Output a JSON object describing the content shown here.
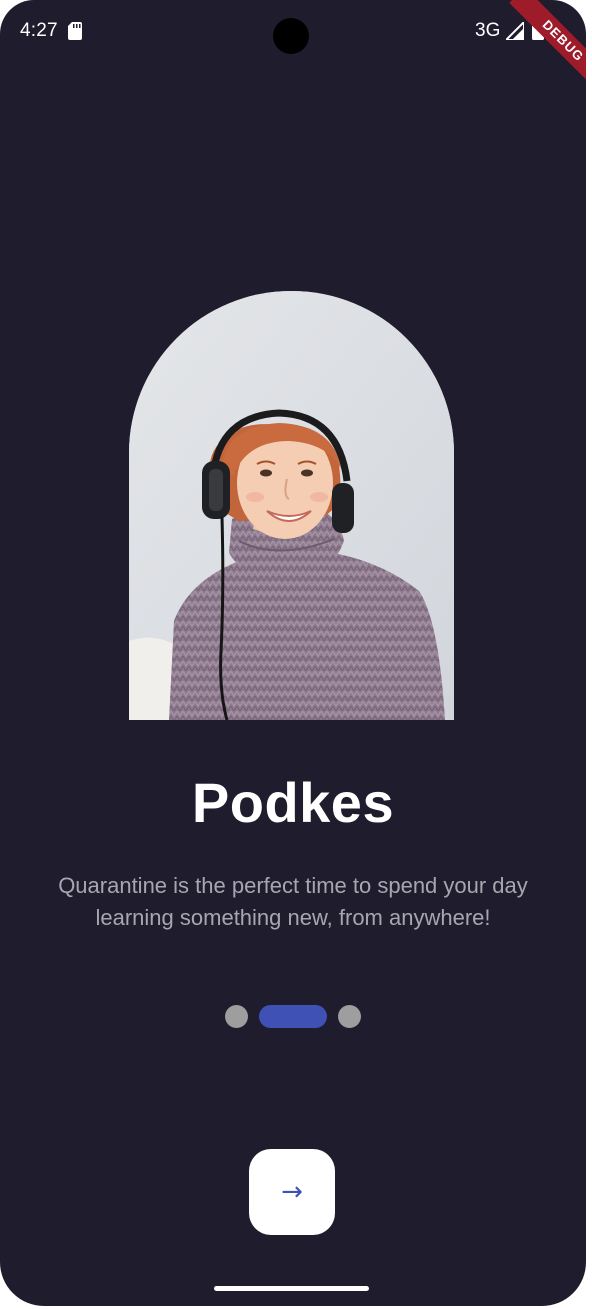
{
  "status_bar": {
    "time": "4:27",
    "network": "3G",
    "icons": [
      "sd-card-icon",
      "signal-icon",
      "battery-icon"
    ]
  },
  "debug_banner": "DEBUG",
  "onboarding": {
    "title": "Podkes",
    "subtitle": "Quarantine is the perfect time to spend your day learning something new, from anywhere!",
    "hero_image": "woman-with-headphones-photo",
    "pager": {
      "total_pages": 3,
      "current_page": 2
    },
    "next_button_icon": "arrow-right-icon",
    "next_button_glyph": "→"
  },
  "colors": {
    "background": "#1f1d2d",
    "accent": "#3f51b5",
    "inactive_dot": "#9e9e9e",
    "subtitle_text": "#a6a6b0",
    "debug_banner": "#9e1b2a"
  }
}
